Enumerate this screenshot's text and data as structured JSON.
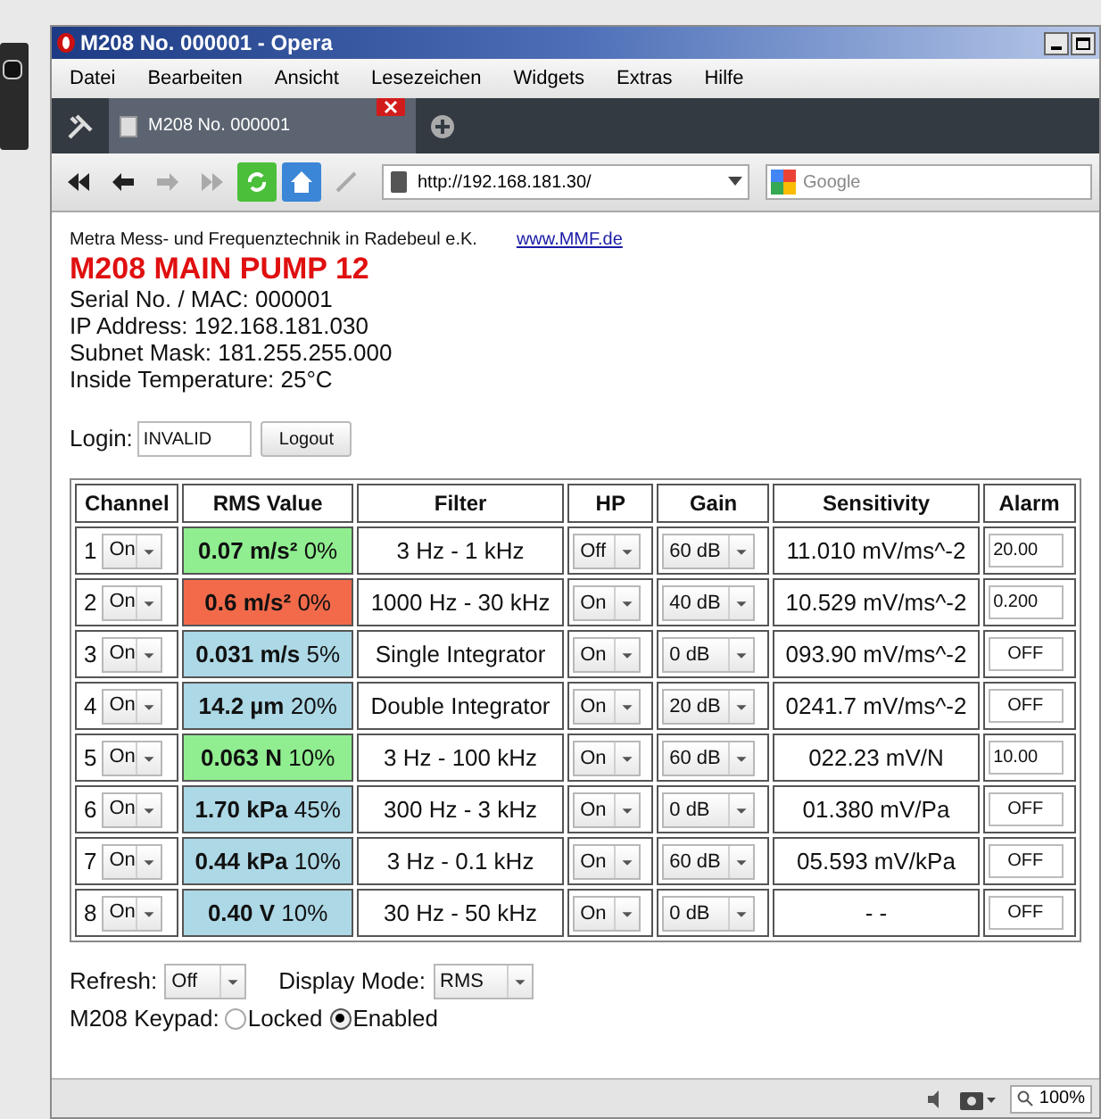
{
  "window": {
    "title": "M208 No. 000001 - Opera"
  },
  "menu": [
    "Datei",
    "Bearbeiten",
    "Ansicht",
    "Lesezeichen",
    "Widgets",
    "Extras",
    "Hilfe"
  ],
  "tabs": [
    {
      "label": "M208 No. 000001",
      "selected": true
    }
  ],
  "address": {
    "value": "http://192.168.181.30/"
  },
  "search": {
    "placeholder": "Google"
  },
  "header": {
    "company": "Metra Mess- und Frequenztechnik in Radebeul e.K.",
    "link": "www.MMF.de",
    "title": "M208 MAIN PUMP 12",
    "lines": [
      "Serial No. / MAC: 000001",
      "IP Address: 192.168.181.030",
      "Subnet Mask: 181.255.255.000",
      "Inside Temperature: 25°C"
    ]
  },
  "login": {
    "label": "Login:",
    "value": "INVALID",
    "button": "Logout"
  },
  "table": {
    "columns": [
      "Channel",
      "RMS Value",
      "Filter",
      "HP",
      "Gain",
      "Sensitivity",
      "Alarm"
    ],
    "rows": [
      {
        "channel": "1",
        "state": "On",
        "value": "0.07 m/s²",
        "percent": "0%",
        "color": "#90ee90",
        "filter": "3 Hz - 1 kHz",
        "hp": "Off",
        "gain": "60 dB",
        "sensitivity": "11.010 mV/ms^-2",
        "alarm": "20.00"
      },
      {
        "channel": "2",
        "state": "On",
        "value": "0.6 m/s²",
        "percent": "0%",
        "color": "#f26a4a",
        "filter": "1000 Hz - 30 kHz",
        "hp": "On",
        "gain": "40 dB",
        "sensitivity": "10.529 mV/ms^-2",
        "alarm": "0.200"
      },
      {
        "channel": "3",
        "state": "On",
        "value": "0.031 m/s",
        "percent": "5%",
        "color": "#add8e6",
        "filter": "Single Integrator",
        "hp": "On",
        "gain": "0 dB",
        "sensitivity": "093.90 mV/ms^-2",
        "alarm": "OFF"
      },
      {
        "channel": "4",
        "state": "On",
        "value": "14.2 µm",
        "percent": "20%",
        "color": "#add8e6",
        "filter": "Double Integrator",
        "hp": "On",
        "gain": "20 dB",
        "sensitivity": "0241.7 mV/ms^-2",
        "alarm": "OFF"
      },
      {
        "channel": "5",
        "state": "On",
        "value": "0.063 N",
        "percent": "10%",
        "color": "#90ee90",
        "filter": "3 Hz - 100 kHz",
        "hp": "On",
        "gain": "60 dB",
        "sensitivity": "022.23 mV/N",
        "alarm": "10.00"
      },
      {
        "channel": "6",
        "state": "On",
        "value": "1.70 kPa",
        "percent": "45%",
        "color": "#add8e6",
        "filter": "300 Hz - 3 kHz",
        "hp": "On",
        "gain": "0 dB",
        "sensitivity": "01.380 mV/Pa",
        "alarm": "OFF"
      },
      {
        "channel": "7",
        "state": "On",
        "value": "0.44 kPa",
        "percent": "10%",
        "color": "#add8e6",
        "filter": "3 Hz - 0.1 kHz",
        "hp": "On",
        "gain": "60 dB",
        "sensitivity": "05.593 mV/kPa",
        "alarm": "OFF"
      },
      {
        "channel": "8",
        "state": "On",
        "value": "0.40 V",
        "percent": "10%",
        "color": "#add8e6",
        "filter": "30 Hz - 50 kHz",
        "hp": "On",
        "gain": "0 dB",
        "sensitivity": "- -",
        "alarm": "OFF"
      }
    ]
  },
  "refresh": {
    "label": "Refresh:",
    "value": "Off"
  },
  "display_mode": {
    "label": "Display Mode:",
    "value": "RMS"
  },
  "keypad": {
    "label": "M208 Keypad:",
    "options": [
      {
        "label": "Locked",
        "selected": false
      },
      {
        "label": "Enabled",
        "selected": true
      }
    ]
  },
  "status_bar": {
    "zoom": "100%"
  }
}
